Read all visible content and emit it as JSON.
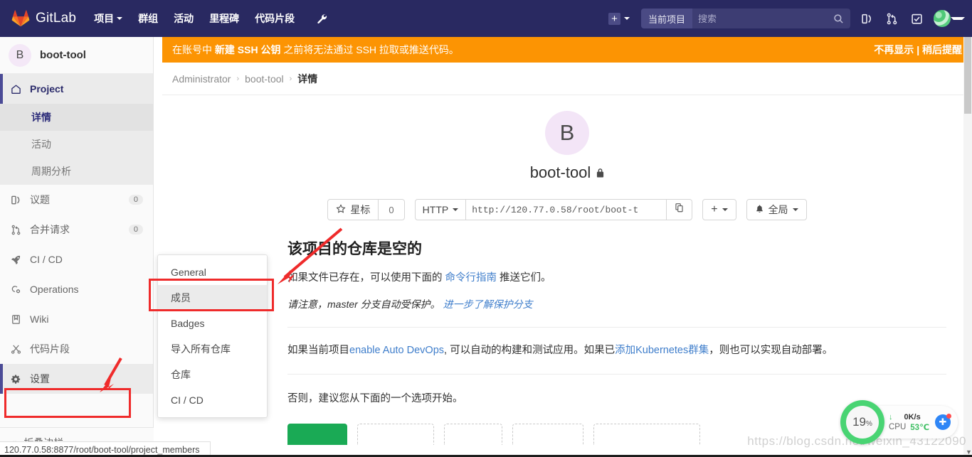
{
  "navbar": {
    "brand": "GitLab",
    "logo_icon": "gitlab-tanuki-icon",
    "links": [
      {
        "label": "项目",
        "has_caret": true
      },
      {
        "label": "群组",
        "has_caret": false
      },
      {
        "label": "活动",
        "has_caret": false
      },
      {
        "label": "里程碑",
        "has_caret": false
      },
      {
        "label": "代码片段",
        "has_caret": false
      }
    ],
    "admin_icon": "wrench-icon",
    "plus_label": "+",
    "search": {
      "scope": "当前项目",
      "placeholder": "搜索",
      "value": "",
      "icon": "search-icon"
    },
    "icons": [
      {
        "name": "issues-icon"
      },
      {
        "name": "merge-requests-icon"
      },
      {
        "name": "todos-icon"
      }
    ],
    "avatar_alt": "user-avatar"
  },
  "sidebar": {
    "project_initial": "B",
    "project_name": "boot-tool",
    "items": [
      {
        "label": "Project",
        "icon": "home-icon",
        "type": "header"
      },
      {
        "label": "详情",
        "type": "sub",
        "active": true
      },
      {
        "label": "活动",
        "type": "sub",
        "active": false
      },
      {
        "label": "周期分析",
        "type": "sub",
        "active": false
      },
      {
        "label": "议题",
        "icon": "issues-icon",
        "count": "0"
      },
      {
        "label": "合并请求",
        "icon": "merge-icon",
        "count": "0"
      },
      {
        "label": "CI / CD",
        "icon": "rocket-icon",
        "count": ""
      },
      {
        "label": "Operations",
        "icon": "operations-icon",
        "count": ""
      },
      {
        "label": "Wiki",
        "icon": "book-icon",
        "count": ""
      },
      {
        "label": "代码片段",
        "icon": "scissors-icon",
        "count": ""
      },
      {
        "label": "设置",
        "icon": "gear-icon",
        "count": "",
        "highlighted": true
      }
    ],
    "collapse_label": "折叠边栏",
    "collapse_icon": "chevron-double-left-icon"
  },
  "settings_flyout": {
    "items": [
      {
        "label": "General",
        "active": false
      },
      {
        "label": "成员",
        "active": true
      },
      {
        "label": "Badges",
        "active": false
      },
      {
        "label": "导入所有仓库",
        "active": false
      },
      {
        "label": "仓库",
        "active": false
      },
      {
        "label": "CI / CD",
        "active": false
      }
    ]
  },
  "alert": {
    "text_before": "在账号中 ",
    "link": "新建 SSH 公钥",
    "text_after": " 之前将无法通过 SSH 拉取或推送代码。",
    "dismiss": "不再显示",
    "separator": "|",
    "remind": "稍后提醒",
    "color": "#fc9403"
  },
  "breadcrumb": {
    "items": [
      "Administrator",
      "boot-tool"
    ],
    "current": "详情",
    "separator": "›"
  },
  "project": {
    "initial": "B",
    "name": "boot-tool",
    "visibility_icon": "lock-icon"
  },
  "actions": {
    "star_label": "星标",
    "star_icon": "star-icon",
    "star_count": "0",
    "clone_protocol": "HTTP",
    "clone_url": "http://120.77.0.58/root/boot-t",
    "copy_icon": "copy-icon",
    "plus_label": "+",
    "notify_label": "全局",
    "notify_icon": "bell-icon"
  },
  "empty_repo": {
    "heading": "该项目的仓库是空的",
    "line1_before": "如果文件已存在，可以使用下面的 ",
    "line1_link": "命令行指南",
    "line1_after": " 推送它们。",
    "note_before": "请注意，master 分支自动受保护。",
    "note_link": "进一步了解保护分支",
    "devops_before": "如果当前项目",
    "devops_link": "enable Auto DevOps",
    "devops_mid": ", 可以自动的构建和测试应用。如果已",
    "devops_link2": "添加Kubernetes群集",
    "devops_after": "，则也可以实现自动部署。",
    "otherwise": "否则，建议您从下面的一个选项开始。"
  },
  "statusbar": {
    "url": "120.77.0.58:8877/root/boot-tool/project_members"
  },
  "cpu_widget": {
    "percent": "19",
    "percent_symbol": "%",
    "net_speed": "0K/s",
    "net_icon": "arrow-down-icon",
    "cpu_label": "CPU",
    "cpu_temp": "53℃",
    "boost_icon": "boost-rocket-icon",
    "ring_color": "#49d473"
  },
  "watermark": {
    "text": "https://blog.csdn.net/weixin_43122090"
  }
}
